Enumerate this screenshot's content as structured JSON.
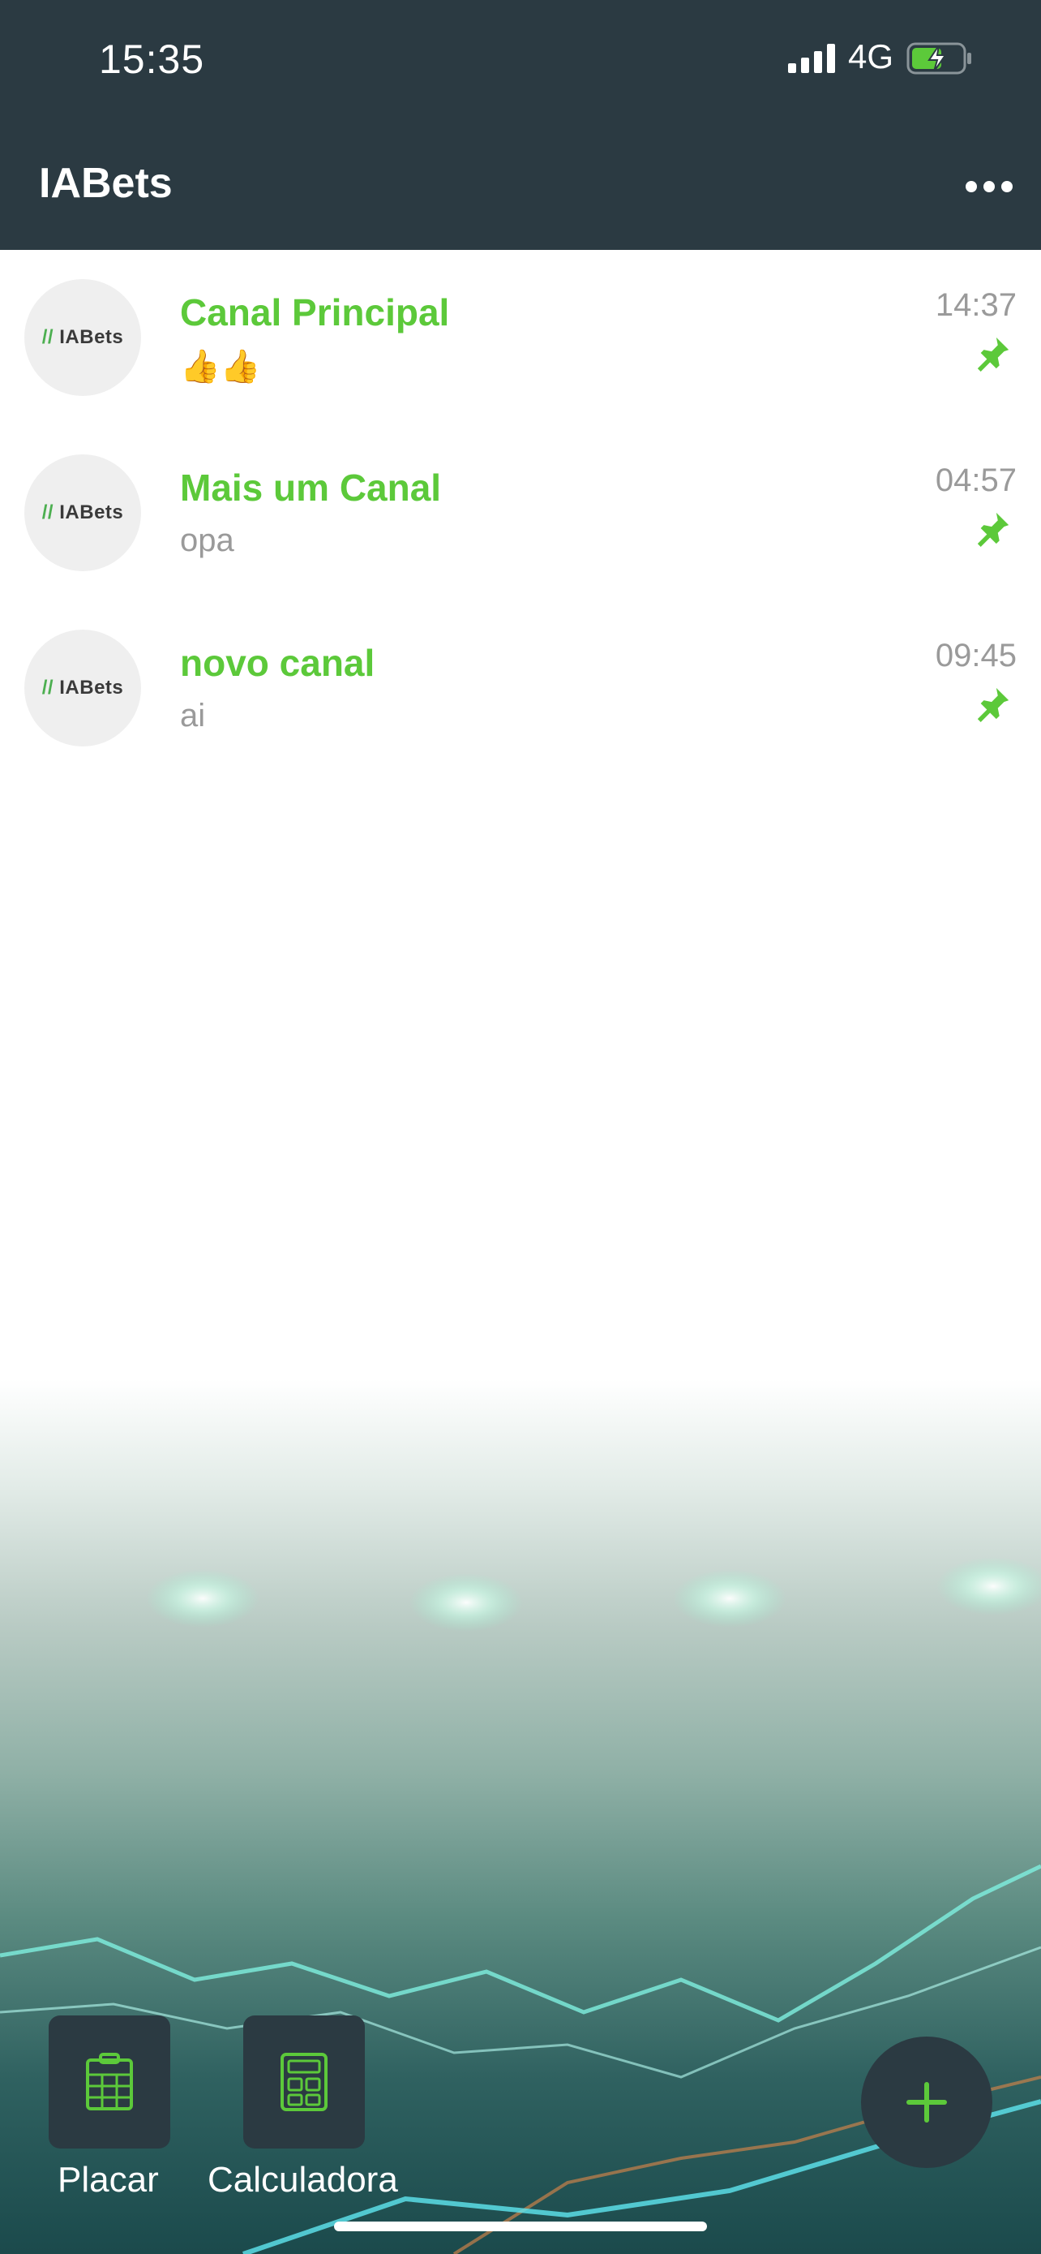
{
  "status_bar": {
    "time": "15:35",
    "network": "4G"
  },
  "app_bar": {
    "title": "IABets",
    "more_icon": "more-horizontal-icon"
  },
  "channels": [
    {
      "name": "Canal Principal",
      "last_message": "👍👍",
      "time": "14:37",
      "pinned": true,
      "avatar_text": "IABets"
    },
    {
      "name": "Mais um Canal",
      "last_message": "opa",
      "time": "04:57",
      "pinned": true,
      "avatar_text": "IABets"
    },
    {
      "name": "novo canal",
      "last_message": "ai",
      "time": "09:45",
      "pinned": true,
      "avatar_text": "IABets"
    }
  ],
  "bottom_actions": [
    {
      "label": "Placar",
      "icon": "scoreboard-icon"
    },
    {
      "label": "Calculadora",
      "icon": "calculator-icon"
    }
  ],
  "fab": {
    "icon": "plus-icon"
  },
  "colors": {
    "header": "#2b3a42",
    "accent": "#5cc93a",
    "muted": "#9a9a9a"
  }
}
